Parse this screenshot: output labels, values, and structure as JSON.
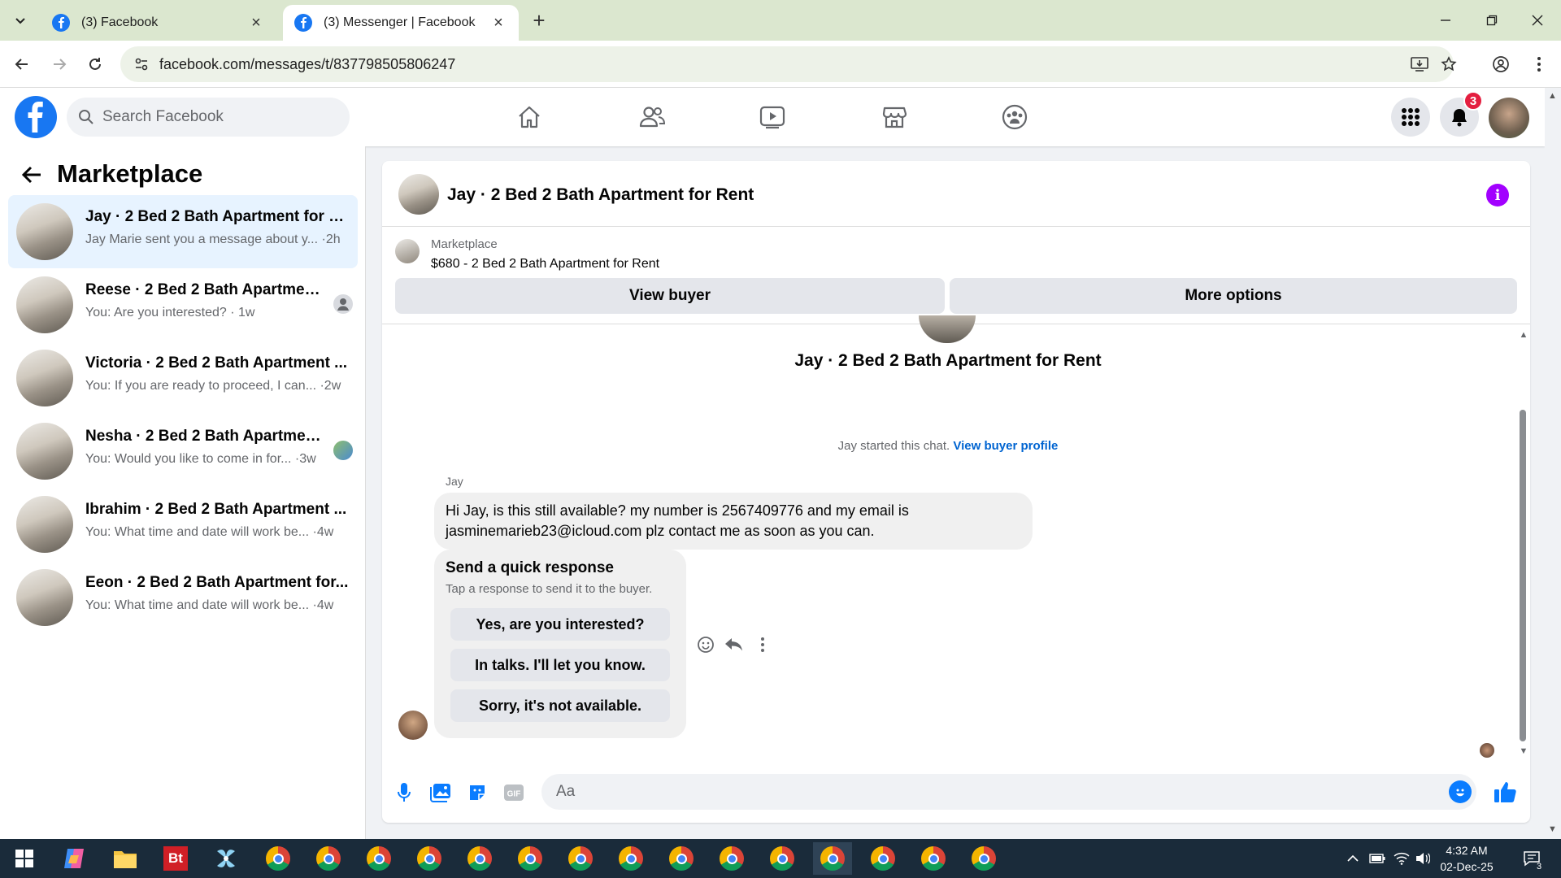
{
  "browser": {
    "tabs": [
      {
        "title": "(3) Facebook"
      },
      {
        "title": "(3) Messenger | Facebook"
      }
    ],
    "url": "facebook.com/messages/t/837798505806247"
  },
  "fb_header": {
    "search_placeholder": "Search Facebook",
    "notification_count": "3"
  },
  "sidebar": {
    "title": "Marketplace",
    "conversations": [
      {
        "name": "Jay · 2 Bed 2 Bath Apartment for R...",
        "preview": "Jay Marie sent you a message about y... ·2h"
      },
      {
        "name": "Reese · 2 Bed 2 Bath Apartment ...",
        "preview": "You: Are you interested? · 1w"
      },
      {
        "name": "Victoria · 2 Bed 2 Bath Apartment ...",
        "preview": "You: If you are ready to proceed, I can... ·2w"
      },
      {
        "name": "Nesha · 2 Bed 2 Bath Apartment...",
        "preview": "You: Would you like to come in for... ·3w"
      },
      {
        "name": "Ibrahim · 2 Bed 2 Bath Apartment ...",
        "preview": "You: What time and date will work be... ·4w"
      },
      {
        "name": "Eeon · 2 Bed 2 Bath Apartment for...",
        "preview": "You: What time and date will work be... ·4w"
      }
    ]
  },
  "chat": {
    "title": "Jay · 2 Bed 2 Bath Apartment for Rent",
    "marketplace_label": "Marketplace",
    "listing": "$680 - 2 Bed 2 Bath Apartment for Rent",
    "view_buyer": "View buyer",
    "more_options": "More options",
    "intro_title": "Jay · 2 Bed 2 Bath Apartment for Rent",
    "started_text": "Jay started this chat.",
    "view_buyer_profile": "View buyer profile",
    "sender": "Jay",
    "message": "Hi Jay, is this still available? my number is 2567409776 and my email is jasminemarieb23@icloud.com plz contact me as soon as you can.",
    "quick_response": {
      "heading": "Send a quick response",
      "subheading": "Tap a response to send it to the buyer.",
      "options": [
        "Yes, are you interested?",
        "In talks. I'll let you know.",
        "Sorry, it's not available."
      ]
    },
    "composer_placeholder": "Aa"
  },
  "taskbar": {
    "time": "4:32 AM",
    "date": "02-Dec-25",
    "notification_count": "3"
  },
  "colors": {
    "facebook_blue": "#1877f2",
    "selected_conversation": "#e7f3ff",
    "link_blue": "#0064d1",
    "info_purple": "#a200ff"
  }
}
